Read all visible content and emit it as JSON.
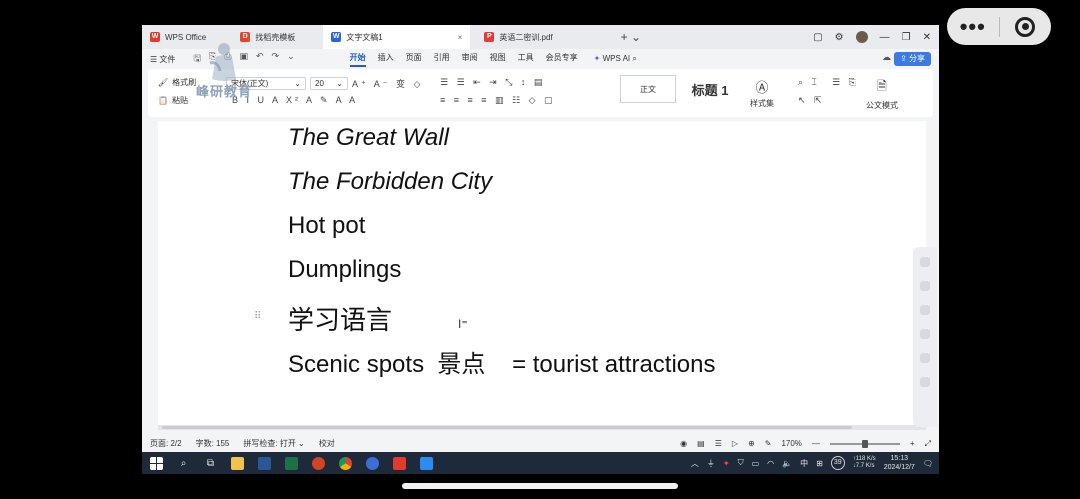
{
  "tabs": [
    {
      "label": "WPS Office",
      "icon": "wps-logo-icon",
      "color": "#e03b2d"
    },
    {
      "label": "找稻壳模板",
      "icon": "docer-icon",
      "color": "#e8452c"
    },
    {
      "label": "文字文稿1",
      "icon": "writer-doc-icon",
      "color": "#2b64d8",
      "active": true
    },
    {
      "label": "英语二密训.pdf",
      "icon": "pdf-icon",
      "color": "#e33a3a"
    }
  ],
  "menubar": {
    "file_label": "文件",
    "items": [
      "开始",
      "插入",
      "页面",
      "引用",
      "审阅",
      "视图",
      "工具",
      "会员专享"
    ],
    "active": "开始",
    "wps_ai": "WPS AI",
    "share": "分享"
  },
  "ribbon": {
    "format_painter": "格式刷",
    "paste": "粘贴",
    "font_name": "宋体(正文)",
    "font_size": "20",
    "style_normal": "正文",
    "style_heading": "标题 1",
    "style_set": "样式集",
    "official_mode": "公文模式"
  },
  "watermark": {
    "text": "峰研教育",
    "color": "#8fa1b8"
  },
  "document": {
    "lines": [
      "The Great Wall",
      "The Forbidden City",
      "Hot pot",
      "Dumplings",
      "学习语言",
      "Scenic spots  景点    = tourist attractions"
    ]
  },
  "statusbar": {
    "page": "页面: 2/2",
    "words": "字数: 155",
    "spellcheck": "拼写检查: 打开",
    "proof": "校对",
    "zoom": "170%",
    "zoom_fraction": 0.5
  },
  "taskbar": {
    "badge": "39",
    "net_up": "↑118 K/s",
    "net_down": "↓7.7 K/s",
    "ime": "中",
    "time": "15:13",
    "date": "2024/12/7"
  }
}
